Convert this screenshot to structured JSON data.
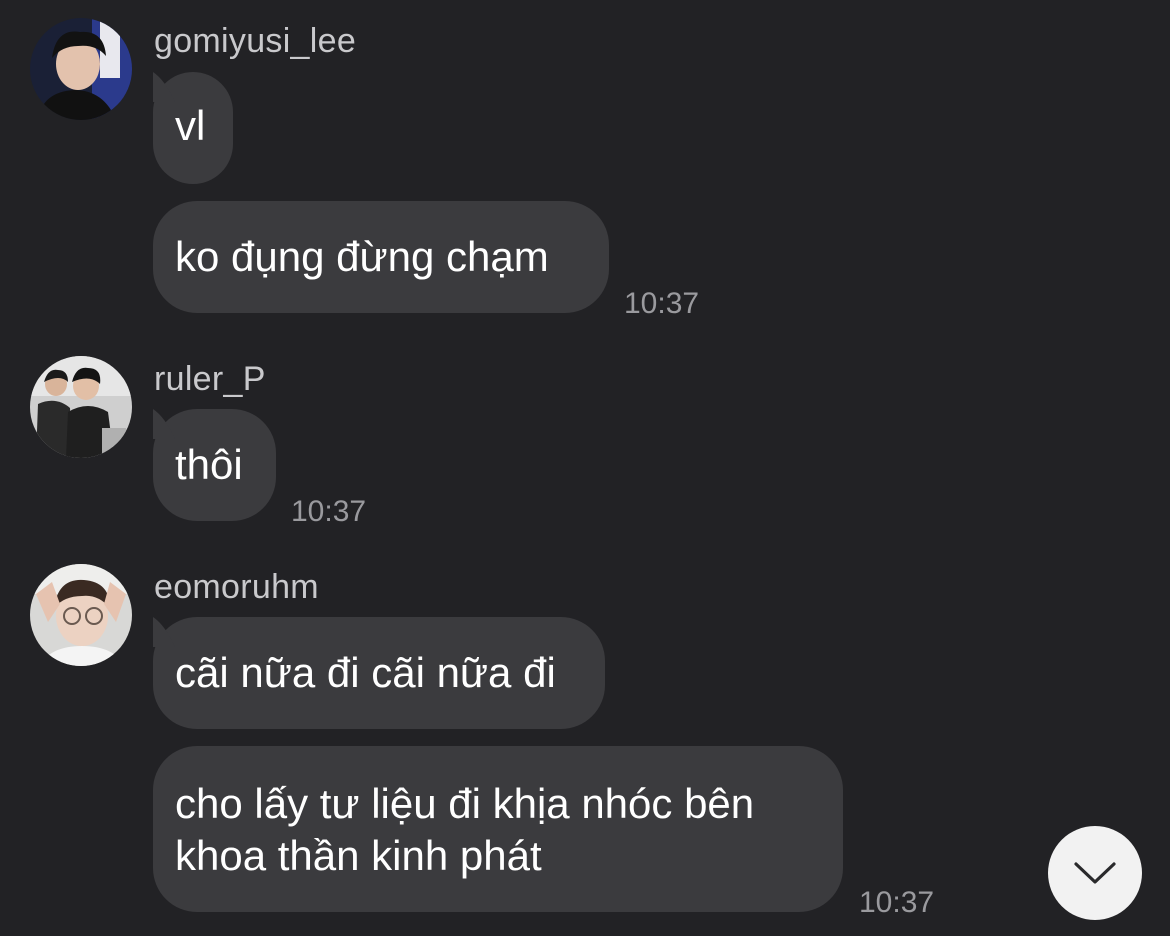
{
  "messages": [
    {
      "user": "gomiyusi_lee",
      "bubbles": [
        "vl",
        "ko đụng đừng chạm"
      ],
      "time": "10:37"
    },
    {
      "user": "ruler_P",
      "bubbles": [
        "thôi"
      ],
      "time": "10:37"
    },
    {
      "user": "eomoruhm",
      "bubbles": [
        "cãi nữa đi cãi nữa đi",
        "cho lấy tư liệu đi khịa nhóc bên\nkhoa thần kinh phát"
      ],
      "time": "10:37"
    }
  ],
  "scroll_button": {
    "icon": "chevron-down-icon"
  },
  "colors": {
    "background": "#222225",
    "bubble": "#3b3b3e",
    "username": "#c9c9cc",
    "timestamp": "#9a9a9e",
    "text": "#ffffff",
    "scroll_button_bg": "#f2f2f2"
  }
}
